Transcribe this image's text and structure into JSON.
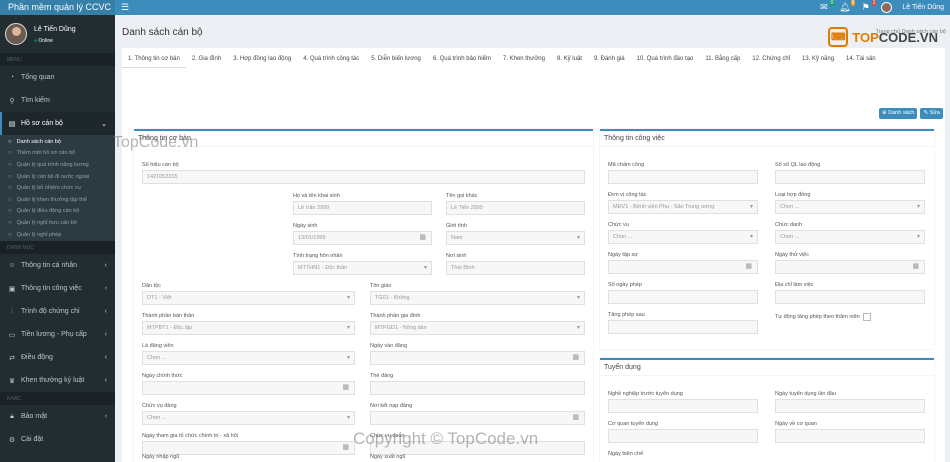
{
  "app": {
    "title": "Phần mềm quản lý CCVC"
  },
  "topbar": {
    "mail_count": "0",
    "bell_count": "6",
    "flag_count": "1",
    "user": "Lê Tiến Dũng"
  },
  "watermark_logo": {
    "text": "TOPCODE.VN",
    "top_text": "TOP",
    "code_text": "CODE.VN"
  },
  "watermarks": [
    "TopCode.vn",
    "Copyright © TopCode.vn"
  ],
  "sidebar": {
    "user": {
      "name": "Lê Tiến Dũng",
      "status": "Online"
    },
    "headers": [
      "MENU",
      "DANH MỤC",
      "KHÁC"
    ],
    "top_items": [
      {
        "label": "Tổng quan",
        "icon": "dashboard-icon"
      },
      {
        "label": "Tìm kiếm",
        "icon": "search-icon"
      },
      {
        "label": "Hồ sơ cán bộ",
        "icon": "folder-icon"
      }
    ],
    "subitems": [
      "Danh sách cán bộ",
      "Thêm mới hồ sơ cán bộ",
      "Quản lý quá trình năng lương",
      "Quản lý cán bộ đi nước ngoài",
      "Quản lý bổ nhiệm chức vụ",
      "Quản lý khen thưởng tập thể",
      "Quản lý điều động cán bộ",
      "Quản lý nghỉ hưu cán bộ",
      "Quản lý nghỉ phép"
    ],
    "category_items": [
      {
        "label": "Thông tin cá nhân",
        "icon": "user-icon"
      },
      {
        "label": "Thông tin công việc",
        "icon": "briefcase-icon"
      },
      {
        "label": "Trình độ chứng chỉ",
        "icon": "certificate-icon"
      },
      {
        "label": "Tiền lương - Phụ cấp",
        "icon": "money-icon"
      },
      {
        "label": "Điều động",
        "icon": "transfer-icon"
      },
      {
        "label": "Khen thưởng kỷ luật",
        "icon": "trophy-icon"
      }
    ],
    "other_items": [
      {
        "label": "Bảo mật",
        "icon": "lock-icon"
      },
      {
        "label": "Cài đặt",
        "icon": "gear-icon"
      }
    ]
  },
  "page": {
    "title": "Danh sách cán bộ",
    "breadcrumb": "Trang chủ    Danh sách cán bộ"
  },
  "tabs": [
    "1. Thông tin cơ bản",
    "2. Gia đình",
    "3. Hợp đồng lao động",
    "4. Quá trình công tác",
    "5. Diễn biến lương",
    "6. Quá trình bảo hiểm",
    "7. Khen thưởng",
    "8. Kỷ luật",
    "9. Đánh giá",
    "10. Quá trình đào tạo",
    "11. Bằng cấp",
    "12. Chứng chỉ",
    "13. Kỹ năng",
    "14. Tài sản"
  ],
  "actions": {
    "list": "Danh sách",
    "edit": "Sửa"
  },
  "basic": {
    "title": "Thông tin cơ bản",
    "fields": {
      "so_hieu": {
        "label": "Số hiệu cán bộ",
        "value": "1421053315"
      },
      "ho_ten": {
        "label": "Họ và tên khai sinh",
        "value": "Lê Văn 2999"
      },
      "ten_goi": {
        "label": "Tên gọi khác",
        "value": "Lê Tiến 2999"
      },
      "ngay_sinh": {
        "label": "Ngày sinh",
        "value": "13/01/1999"
      },
      "gioi_tinh": {
        "label": "Giới tính",
        "value": "Nam"
      },
      "hon_nhan": {
        "label": "Tình trạng hôn nhân",
        "value": "MTTHN1 - Độc thân"
      },
      "noi_sinh": {
        "label": "Nơi sinh",
        "value": "Thái Bình"
      },
      "dan_toc": {
        "label": "Dân tộc",
        "value": "DT1 - Việt"
      },
      "ton_giao": {
        "label": "Tôn giáo",
        "value": "TG01 - Không"
      },
      "tp_ban_than": {
        "label": "Thành phần bản thân",
        "value": "MTPBT1 - Độc lập"
      },
      "tp_gia_dinh": {
        "label": "Thành phần gia đình",
        "value": "MTPGD1 - Nông dân"
      },
      "dang_vien": {
        "label": "Là đảng viên",
        "value": "Chọn ..."
      },
      "ngay_vao_dang": {
        "label": "Ngày vào đảng",
        "value": ""
      },
      "ngay_chinh_thuc": {
        "label": "Ngày chính thức",
        "value": ""
      },
      "the_dang": {
        "label": "Thẻ đảng",
        "value": ""
      },
      "chuc_vu_dang": {
        "label": "Chức vụ đảng",
        "value": "Chọn ..."
      },
      "noi_ket_nap": {
        "label": "Nơi kết nạp đảng",
        "value": ""
      },
      "ngay_tham_gia": {
        "label": "Ngày tham gia tổ chức chính trị - xã hội",
        "value": ""
      },
      "chuc_vu_doan": {
        "label": "Chức vụ đoàn",
        "value": ""
      },
      "ngay_nhap_ngu": {
        "label": "Ngày nhập ngũ",
        "value": ""
      },
      "ngay_xuat_ngu": {
        "label": "Ngày xuất ngũ",
        "value": ""
      }
    }
  },
  "work": {
    "title": "Thông tin công việc",
    "fields": {
      "ma_cham_cong": {
        "label": "Mã chấm công",
        "value": ""
      },
      "so_so_ql": {
        "label": "Số sổ QL lao động",
        "value": ""
      },
      "don_vi": {
        "label": "Đơn vị công tác",
        "value": "MĐV1 - Bệnh viện Phụ - Sản Trung ương"
      },
      "loai_hop_dong": {
        "label": "Loại hợp đồng",
        "value": "Chọn ..."
      },
      "chuc_vu": {
        "label": "Chức vụ",
        "value": "Chọn ..."
      },
      "chuc_danh": {
        "label": "Chức danh",
        "value": "Chọn ..."
      },
      "ngay_tap_su": {
        "label": "Ngày tập sự",
        "value": ""
      },
      "ngay_thu_viec": {
        "label": "Ngày thử việc",
        "value": ""
      },
      "so_ngay_phep": {
        "label": "Số ngày phép",
        "value": ""
      },
      "dia_chi": {
        "label": "Địa chỉ làm việc",
        "value": ""
      },
      "tang_phep": {
        "label": "Tăng phép sau",
        "value": ""
      },
      "tu_dong": {
        "label": "Tự động tăng phép theo thâm niên",
        "value": ""
      }
    }
  },
  "recruit": {
    "title": "Tuyển dụng",
    "fields": {
      "nghe_nghiep": {
        "label": "Nghề nghiệp trước tuyển dụng",
        "value": ""
      },
      "ngay_td": {
        "label": "Ngày tuyển dụng lần đầu",
        "value": ""
      },
      "co_quan": {
        "label": "Cơ quan tuyển dụng",
        "value": ""
      },
      "ngay_ve": {
        "label": "Ngày về cơ quan",
        "value": ""
      },
      "ngay_bien_che": {
        "label": "Ngày biên chế",
        "value": ""
      }
    }
  }
}
